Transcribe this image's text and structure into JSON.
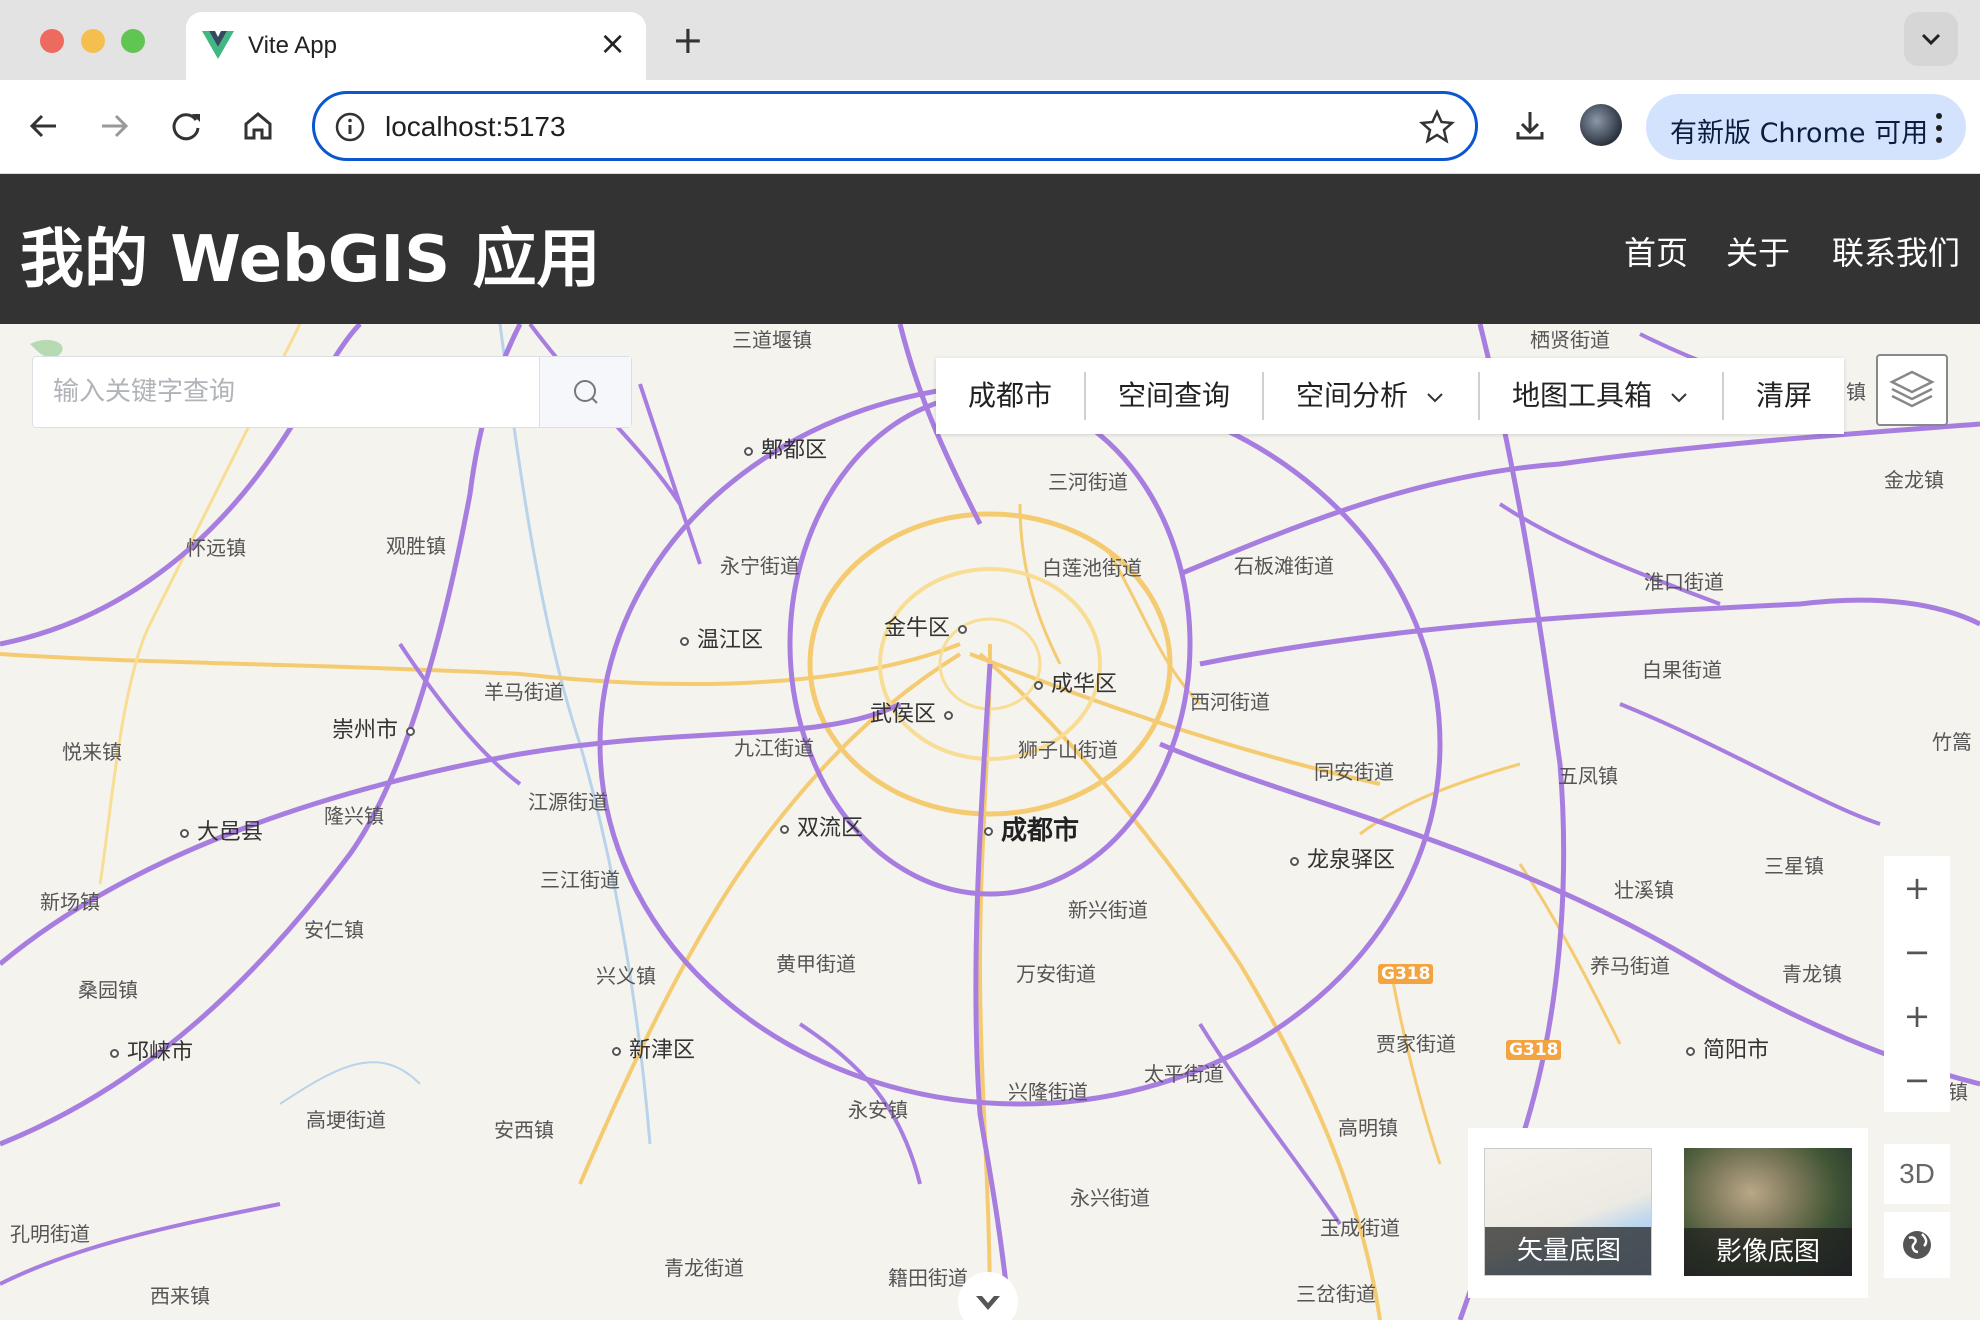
{
  "browser": {
    "tab_title": "Vite App",
    "new_tab_symbol": "+",
    "close_symbol": "×",
    "url": "localhost:5173",
    "update_button": "有新版 Chrome 可用"
  },
  "app": {
    "title": "我的 WebGIS 应用",
    "nav": [
      "首页",
      "关于",
      "联系我们"
    ]
  },
  "search": {
    "placeholder": "输入关键字查询"
  },
  "menu": {
    "items": [
      "成都市",
      "空间查询",
      "空间分析",
      "地图工具箱",
      "清屏"
    ]
  },
  "map_controls": {
    "zoom_in": "+",
    "zoom_out": "−",
    "zoom_in_2": "+",
    "zoom_out_2": "−",
    "mode_3d": "3D"
  },
  "basemaps": [
    "矢量底图",
    "影像底图"
  ],
  "map_labels": {
    "towns": [
      "三道堰镇",
      "栖贤街道",
      "金龙镇",
      "三河街道",
      "怀远镇",
      "观胜镇",
      "永宁街道",
      "白莲池街道",
      "石板滩街道",
      "淮口街道",
      "白果街道",
      "悦来镇",
      "羊马街道",
      "西河街道",
      "九江街道",
      "狮子山街道",
      "同安街道",
      "五凤镇",
      "竹篙",
      "隆兴镇",
      "江源街道",
      "新兴街道",
      "三星镇",
      "新场镇",
      "安仁镇",
      "三江街道",
      "壮溪镇",
      "黄甲街道",
      "万安街道",
      "养马街道",
      "青龙镇",
      "桑园镇",
      "兴义镇",
      "贾家街道",
      "太平街道",
      "高埂街道",
      "安西镇",
      "永安镇",
      "兴隆街道",
      "高明镇",
      "永兴街道",
      "玉成街道",
      "孔明街道",
      "青龙街道",
      "籍田街道",
      "三岔街道",
      "西来镇",
      "镇",
      "镇",
      "镇"
    ],
    "districts": [
      "郫都区",
      "温江区",
      "金牛区",
      "成华区",
      "武侯区",
      "崇州市",
      "大邑县",
      "双流区",
      "龙泉驿区",
      "邛崃市",
      "新津区",
      "简阳市"
    ],
    "city": "成都市",
    "shields": [
      "G318",
      "G318"
    ]
  }
}
